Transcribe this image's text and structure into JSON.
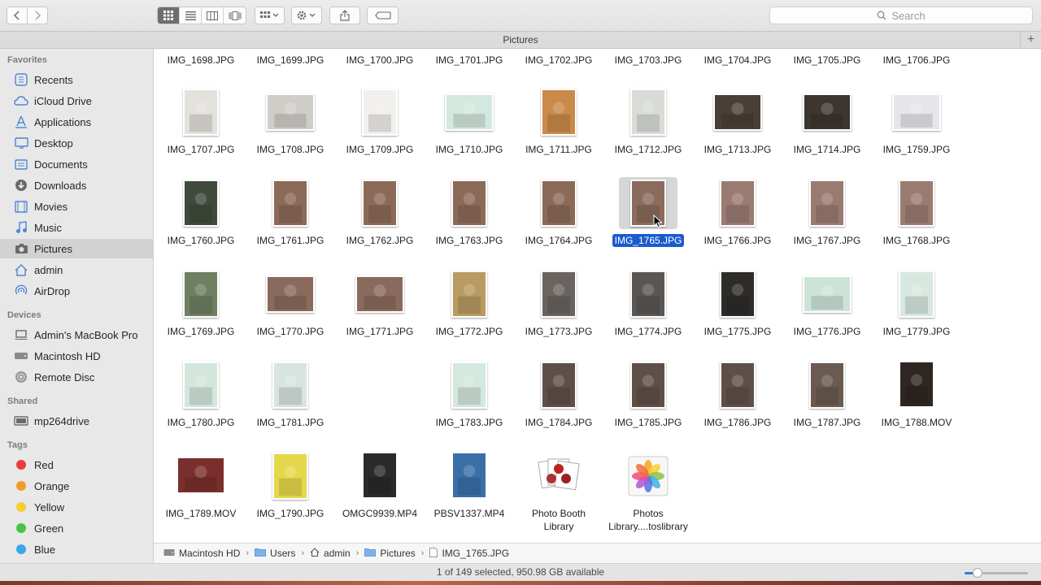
{
  "toolbar": {
    "back_icon": "chevron-left-icon",
    "forward_icon": "chevron-right-icon",
    "view_modes": [
      "icon-view-icon",
      "list-view-icon",
      "column-view-icon",
      "cover-flow-icon"
    ],
    "active_view": "icon-view-icon",
    "search_placeholder": "Search"
  },
  "window": {
    "title": "Pictures"
  },
  "sidebar": {
    "sections": [
      {
        "title": "Favorites",
        "items": [
          {
            "label": "Recents",
            "icon": "recents-icon"
          },
          {
            "label": "iCloud Drive",
            "icon": "cloud-icon"
          },
          {
            "label": "Applications",
            "icon": "applications-icon"
          },
          {
            "label": "Desktop",
            "icon": "desktop-icon"
          },
          {
            "label": "Documents",
            "icon": "documents-icon"
          },
          {
            "label": "Downloads",
            "icon": "downloads-icon"
          },
          {
            "label": "Movies",
            "icon": "movies-icon"
          },
          {
            "label": "Music",
            "icon": "music-icon"
          },
          {
            "label": "Pictures",
            "icon": "camera-icon",
            "selected": true
          },
          {
            "label": "admin",
            "icon": "home-icon"
          },
          {
            "label": "AirDrop",
            "icon": "airdrop-icon"
          }
        ]
      },
      {
        "title": "Devices",
        "items": [
          {
            "label": "Admin's MacBook Pro",
            "icon": "laptop-icon"
          },
          {
            "label": "Macintosh HD",
            "icon": "harddrive-icon"
          },
          {
            "label": "Remote Disc",
            "icon": "disc-icon"
          }
        ]
      },
      {
        "title": "Shared",
        "items": [
          {
            "label": "mp264drive",
            "icon": "server-icon"
          }
        ]
      },
      {
        "title": "Tags",
        "items": [
          {
            "label": "Red",
            "color": "#ec3b3b"
          },
          {
            "label": "Orange",
            "color": "#f39a2b"
          },
          {
            "label": "Yellow",
            "color": "#f5cd30"
          },
          {
            "label": "Green",
            "color": "#48c443"
          },
          {
            "label": "Blue",
            "color": "#3aa7ee"
          }
        ]
      }
    ]
  },
  "files": {
    "rows": [
      [
        {
          "name": "IMG_1698.JPG"
        },
        {
          "name": "IMG_1699.JPG"
        },
        {
          "name": "IMG_1700.JPG"
        },
        {
          "name": "IMG_1701.JPG"
        },
        {
          "name": "IMG_1702.JPG"
        },
        {
          "name": "IMG_1703.JPG"
        },
        {
          "name": "IMG_1704.JPG"
        },
        {
          "name": "IMG_1705.JPG"
        },
        {
          "name": "IMG_1706.JPG"
        }
      ],
      [
        {
          "name": "IMG_1707.JPG",
          "orient": "p",
          "tone": "#e3e1dc"
        },
        {
          "name": "IMG_1708.JPG",
          "orient": "l",
          "tone": "#cfcdc8"
        },
        {
          "name": "IMG_1709.JPG",
          "orient": "p",
          "tone": "#f2f0ec"
        },
        {
          "name": "IMG_1710.JPG",
          "orient": "l",
          "tone": "#d3e8df"
        },
        {
          "name": "IMG_1711.JPG",
          "orient": "p",
          "tone": "#c98a4a"
        },
        {
          "name": "IMG_1712.JPG",
          "orient": "p",
          "tone": "#d9dcd6"
        },
        {
          "name": "IMG_1713.JPG",
          "orient": "l",
          "tone": "#4a3f36"
        },
        {
          "name": "IMG_1714.JPG",
          "orient": "l",
          "tone": "#3d3630"
        },
        {
          "name": "IMG_1759.JPG",
          "orient": "l",
          "tone": "#e6e6ea"
        }
      ],
      [
        {
          "name": "IMG_1760.JPG",
          "orient": "p",
          "tone": "#3f4a3c"
        },
        {
          "name": "IMG_1761.JPG",
          "orient": "p",
          "tone": "#8c6a58"
        },
        {
          "name": "IMG_1762.JPG",
          "orient": "p",
          "tone": "#8c6a58"
        },
        {
          "name": "IMG_1763.JPG",
          "orient": "p",
          "tone": "#8c6a58"
        },
        {
          "name": "IMG_1764.JPG",
          "orient": "p",
          "tone": "#8c6a58"
        },
        {
          "name": "IMG_1765.JPG",
          "orient": "p",
          "tone": "#8a6b5c",
          "selected": true
        },
        {
          "name": "IMG_1766.JPG",
          "orient": "p",
          "tone": "#9a7b72"
        },
        {
          "name": "IMG_1767.JPG",
          "orient": "p",
          "tone": "#9a7b72"
        },
        {
          "name": "IMG_1768.JPG",
          "orient": "p",
          "tone": "#9a7b72"
        }
      ],
      [
        {
          "name": "IMG_1769.JPG",
          "orient": "p",
          "tone": "#6e7f62"
        },
        {
          "name": "IMG_1770.JPG",
          "orient": "l",
          "tone": "#8a6a5c"
        },
        {
          "name": "IMG_1771.JPG",
          "orient": "l",
          "tone": "#8a6a5c"
        },
        {
          "name": "IMG_1772.JPG",
          "orient": "p",
          "tone": "#b89a62"
        },
        {
          "name": "IMG_1773.JPG",
          "orient": "p",
          "tone": "#6a6460"
        },
        {
          "name": "IMG_1774.JPG",
          "orient": "p",
          "tone": "#5a5654"
        },
        {
          "name": "IMG_1775.JPG",
          "orient": "p",
          "tone": "#2e2c2a"
        },
        {
          "name": "IMG_1776.JPG",
          "orient": "l",
          "tone": "#cde3d8"
        },
        {
          "name": "IMG_1779.JPG",
          "orient": "p",
          "tone": "#d8e8e0"
        }
      ],
      [
        {
          "name": "IMG_1780.JPG",
          "orient": "p",
          "tone": "#d2e6dc"
        },
        {
          "name": "IMG_1781.JPG",
          "orient": "p",
          "tone": "#d8e4e0"
        },
        {
          "name": ""
        },
        {
          "name": "IMG_1783.JPG",
          "orient": "p",
          "tone": "#d4e8de"
        },
        {
          "name": "IMG_1784.JPG",
          "orient": "p",
          "tone": "#5e5048"
        },
        {
          "name": "IMG_1785.JPG",
          "orient": "p",
          "tone": "#5e5048"
        },
        {
          "name": "IMG_1786.JPG",
          "orient": "p",
          "tone": "#5e5048"
        },
        {
          "name": "IMG_1787.JPG",
          "orient": "p",
          "tone": "#6a5a50"
        },
        {
          "name": "IMG_1788.MOV",
          "orient": "p",
          "tone": "#2e2622",
          "bare": true
        }
      ],
      [
        {
          "name": "IMG_1789.MOV",
          "orient": "l",
          "tone": "#7a2f2c",
          "bare": true
        },
        {
          "name": "IMG_1790.JPG",
          "orient": "p",
          "tone": "#e4d84a"
        },
        {
          "name": "OMGC9939.MP4",
          "orient": "p",
          "tone": "#2a2a2a",
          "bare": true
        },
        {
          "name": "PBSV1337.MP4",
          "orient": "p",
          "tone": "#3a6fa8",
          "bare": true
        },
        {
          "name": "Photo Booth\nLibrary",
          "special": "photobooth"
        },
        {
          "name": "Photos\nLibrary....toslibrary",
          "special": "photos"
        }
      ]
    ]
  },
  "pathbar": {
    "crumbs": [
      {
        "label": "Macintosh HD",
        "icon": "harddrive-icon"
      },
      {
        "label": "Users",
        "icon": "folder-icon"
      },
      {
        "label": "admin",
        "icon": "home-icon"
      },
      {
        "label": "Pictures",
        "icon": "folder-icon"
      },
      {
        "label": "IMG_1765.JPG",
        "icon": "file-icon"
      }
    ]
  },
  "status": {
    "text": "1 of 149 selected, 950.98 GB available",
    "icon_size_slider": 0.2
  },
  "colors": {
    "selection": "#1a5ccf",
    "accent": "#3c7bd9"
  }
}
